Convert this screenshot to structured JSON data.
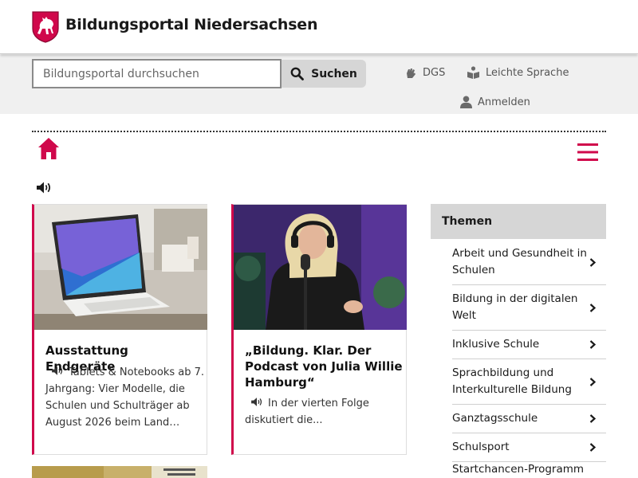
{
  "header": {
    "title": "Bildungsportal Niedersachsen"
  },
  "search": {
    "placeholder": "Bildungsportal durchsuchen",
    "button_label": "Suchen"
  },
  "toolbar": {
    "dgs_label": "DGS",
    "leichte_sprache_label": "Leichte Sprache",
    "login_label": "Anmelden"
  },
  "colors": {
    "accent": "#d0084b",
    "toolbar_bg": "#f0f0f0",
    "panel_head_bg": "#d6d6d6"
  },
  "icons": {
    "home": "home-icon",
    "menu": "hamburger-menu-icon",
    "speaker": "speaker-icon",
    "search": "search-icon"
  },
  "cards": [
    {
      "title": "Ausstattung Endgeräte",
      "teaser": "Tablets & Notebooks ab 7. Jahrgang: Vier Modelle, die Schulen und Schulträger ab August 2026 beim Land…"
    },
    {
      "title": "„Bildung. Klar. Der Podcast von Julia Willie Hamburg“",
      "teaser": "In der vierten Folge diskutiert die..."
    }
  ],
  "themen": {
    "heading": "Themen",
    "items": [
      {
        "label": "Arbeit und Gesundheit in Schulen"
      },
      {
        "label": "Bildung in der digitalen Welt"
      },
      {
        "label": "Inklusive Schule"
      },
      {
        "label": "Sprachbildung und Interkulturelle Bildung"
      },
      {
        "label": "Ganztagsschule"
      },
      {
        "label": "Schulsport"
      },
      {
        "label": "Startchancen-Programm"
      }
    ]
  }
}
